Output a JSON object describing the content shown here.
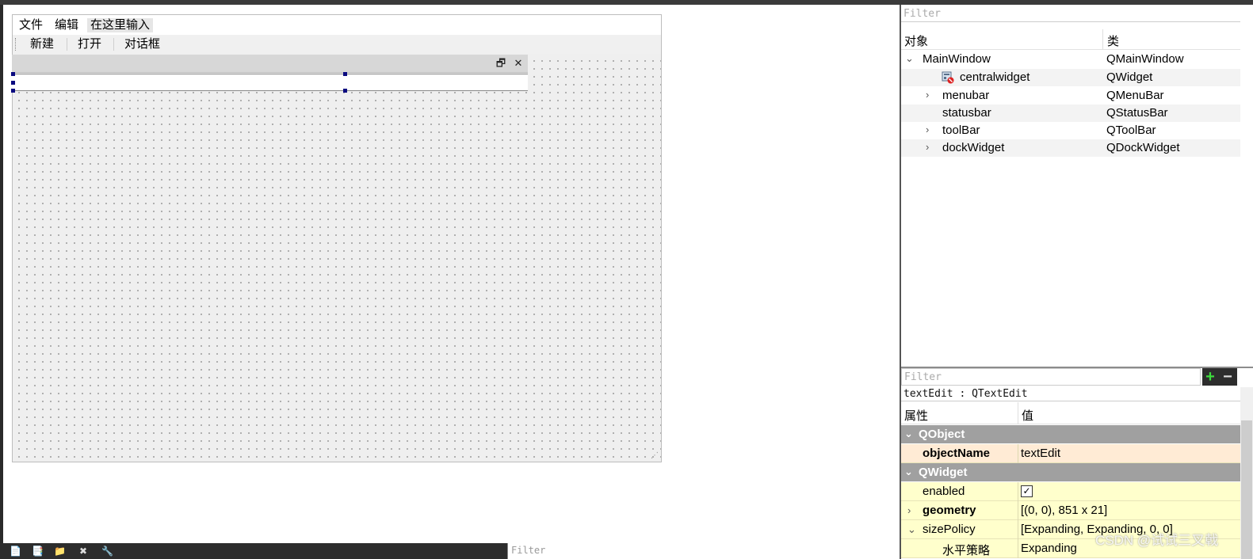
{
  "form": {
    "menu": [
      "文件",
      "编辑",
      "在这里输入"
    ],
    "toolbar": [
      "新建",
      "打开",
      "对话框"
    ],
    "dock_buttons": {
      "float": "🗗",
      "close": "✕"
    },
    "resize_grip": "⋰"
  },
  "bottom": {
    "icons": [
      "📄",
      "📑",
      "📁",
      "✖",
      "🔧"
    ],
    "filter_placeholder": "Filter"
  },
  "object_inspector": {
    "filter_placeholder": "Filter",
    "headers": {
      "object": "对象",
      "class": "类"
    },
    "rows": [
      {
        "name": "MainWindow",
        "cls": "QMainWindow",
        "arrow": "⌄"
      },
      {
        "name": "centralwidget",
        "cls": "QWidget",
        "arrow": ""
      },
      {
        "name": "menubar",
        "cls": "QMenuBar",
        "arrow": "›"
      },
      {
        "name": "statusbar",
        "cls": "QStatusBar",
        "arrow": ""
      },
      {
        "name": "toolBar",
        "cls": "QToolBar",
        "arrow": "›"
      },
      {
        "name": "dockWidget",
        "cls": "QDockWidget",
        "arrow": "›"
      }
    ]
  },
  "property_editor": {
    "filter_placeholder": "Filter",
    "add": "+",
    "remove": "−",
    "target": "textEdit : QTextEdit",
    "headers": {
      "property": "属性",
      "value": "值"
    },
    "groups": [
      {
        "label": "QObject"
      },
      {
        "label": "QWidget"
      }
    ],
    "rows": [
      {
        "name": "objectName",
        "value": "textEdit",
        "arrow": ""
      },
      {
        "name": "enabled",
        "value": "✓",
        "arrow": ""
      },
      {
        "name": "geometry",
        "value": "[(0, 0), 851 x 21]",
        "arrow": "›"
      },
      {
        "name": "sizePolicy",
        "value": "[Expanding, Expanding, 0, 0]",
        "arrow": "⌄"
      },
      {
        "name": "水平策略",
        "value": "Expanding",
        "arrow": ""
      }
    ]
  },
  "watermark": "CSDN @试试三叉戟",
  "colors": {
    "selection_handle": "#0a0a80",
    "group_bg": "#a0a0a0",
    "prop_bg": "#ffffcc",
    "prop_highlight": "#ffebd5",
    "add_green": "#3ddc3d"
  }
}
